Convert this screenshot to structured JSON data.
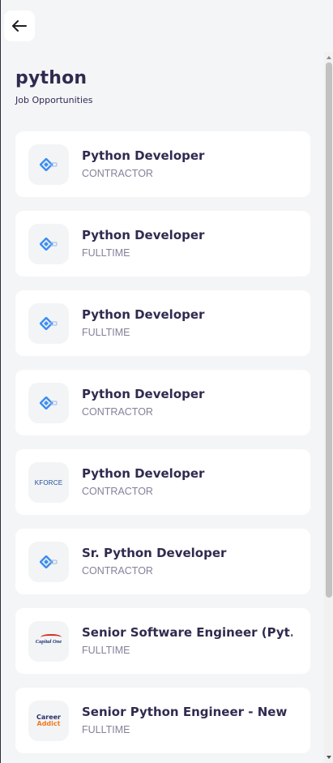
{
  "header": {
    "title": "python",
    "subtitle": "Job Opportunities"
  },
  "jobs": [
    {
      "title": "Python Developer",
      "type": "CONTRACTOR",
      "logo": "generic-company-logo-icon"
    },
    {
      "title": "Python Developer",
      "type": "FULLTIME",
      "logo": "generic-company-logo-icon"
    },
    {
      "title": "Python Developer",
      "type": "FULLTIME",
      "logo": "generic-company-logo-icon"
    },
    {
      "title": "Python Developer",
      "type": "CONTRACTOR",
      "logo": "generic-company-logo-icon"
    },
    {
      "title": "Python Developer",
      "type": "CONTRACTOR",
      "logo": "kforce-logo",
      "logo_text": "KFORCE"
    },
    {
      "title": "Sr. Python Developer",
      "type": "CONTRACTOR",
      "logo": "generic-company-logo-icon"
    },
    {
      "title": "Senior Software Engineer (Pyt...",
      "type": "FULLTIME",
      "logo": "capital-one-logo",
      "logo_text": "Capital One"
    },
    {
      "title": "Senior Python Engineer - New ...",
      "type": "FULLTIME",
      "logo": "career-addict-logo",
      "logo_text": "Career Addict"
    }
  ],
  "colors": {
    "background": "#f4f5f7",
    "card": "#ffffff",
    "title_text": "#312a4f",
    "secondary_text": "#83829a",
    "logo_blue": "#3d8ef0"
  },
  "icons": {
    "back": "arrow-left-icon"
  }
}
